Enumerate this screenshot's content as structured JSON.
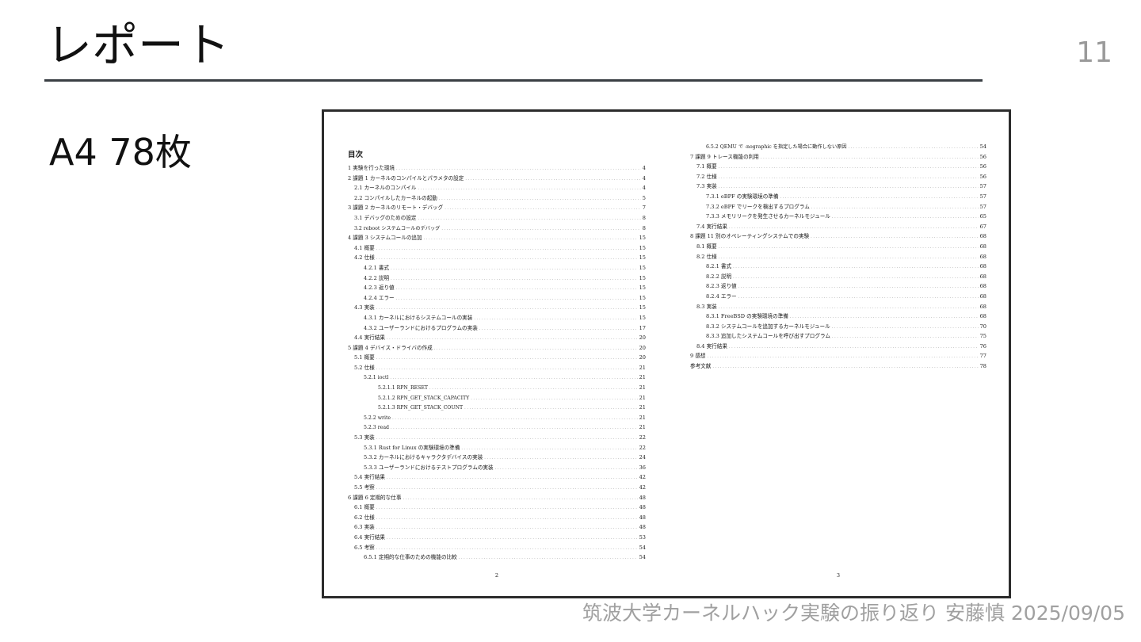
{
  "slide": {
    "title": "レポート",
    "page_number": "11",
    "summary": "A4 78枚",
    "footer": "筑波大学カーネルハック実験の振り返り 安藤慎 2025/09/05"
  },
  "document": {
    "left_page": {
      "heading": "目次",
      "page_number": "2",
      "entries": [
        {
          "level": 0,
          "text": "1 実験を行った環境",
          "page": "4"
        },
        {
          "level": 0,
          "text": "2 課題 1 カーネルのコンパイルとパラメタの設定",
          "page": "4"
        },
        {
          "level": 1,
          "text": "2.1 カーネルのコンパイル",
          "page": "4"
        },
        {
          "level": 1,
          "text": "2.2 コンパイルしたカーネルの起動",
          "page": "5"
        },
        {
          "level": 0,
          "text": "3 課題 2 カーネルのリモート・デバッグ",
          "page": "7"
        },
        {
          "level": 1,
          "text": "3.1 デバッグのための設定",
          "page": "8"
        },
        {
          "level": 1,
          "text": "3.2 reboot システムコールのデバッグ",
          "page": "8"
        },
        {
          "level": 0,
          "text": "4 課題 3 システムコールの追加",
          "page": "15"
        },
        {
          "level": 1,
          "text": "4.1 概要",
          "page": "15"
        },
        {
          "level": 1,
          "text": "4.2 仕様",
          "page": "15"
        },
        {
          "level": 2,
          "text": "4.2.1 書式",
          "page": "15"
        },
        {
          "level": 2,
          "text": "4.2.2 説明",
          "page": "15"
        },
        {
          "level": 2,
          "text": "4.2.3 返り値",
          "page": "15"
        },
        {
          "level": 2,
          "text": "4.2.4 エラー",
          "page": "15"
        },
        {
          "level": 1,
          "text": "4.3 実装",
          "page": "15"
        },
        {
          "level": 2,
          "text": "4.3.1 カーネルにおけるシステムコールの実装",
          "page": "15"
        },
        {
          "level": 2,
          "text": "4.3.2 ユーザーランドにおけるプログラムの実装",
          "page": "17"
        },
        {
          "level": 1,
          "text": "4.4 実行結果",
          "page": "20"
        },
        {
          "level": 0,
          "text": "5 課題 4 デバイス・ドライバの作成",
          "page": "20"
        },
        {
          "level": 1,
          "text": "5.1 概要",
          "page": "20"
        },
        {
          "level": 1,
          "text": "5.2 仕様",
          "page": "21"
        },
        {
          "level": 2,
          "text": "5.2.1 ioctl",
          "page": "21"
        },
        {
          "level": 3,
          "text": "5.2.1.1 RPN_RESET",
          "page": "21"
        },
        {
          "level": 3,
          "text": "5.2.1.2 RPN_GET_STACK_CAPACITY",
          "page": "21"
        },
        {
          "level": 3,
          "text": "5.2.1.3 RPN_GET_STACK_COUNT",
          "page": "21"
        },
        {
          "level": 2,
          "text": "5.2.2 write",
          "page": "21"
        },
        {
          "level": 2,
          "text": "5.2.3 read",
          "page": "21"
        },
        {
          "level": 1,
          "text": "5.3 実装",
          "page": "22"
        },
        {
          "level": 2,
          "text": "5.3.1 Rust for Linux の実験環境の準備",
          "page": "22"
        },
        {
          "level": 2,
          "text": "5.3.2 カーネルにおけるキャラクタデバイスの実装",
          "page": "24"
        },
        {
          "level": 2,
          "text": "5.3.3 ユーザーランドにおけるテストプログラムの実装",
          "page": "36"
        },
        {
          "level": 1,
          "text": "5.4 実行結果",
          "page": "42"
        },
        {
          "level": 1,
          "text": "5.5 考察",
          "page": "42"
        },
        {
          "level": 0,
          "text": "6 課題 6 定期的な仕事",
          "page": "48"
        },
        {
          "level": 1,
          "text": "6.1 概要",
          "page": "48"
        },
        {
          "level": 1,
          "text": "6.2 仕様",
          "page": "48"
        },
        {
          "level": 1,
          "text": "6.3 実装",
          "page": "48"
        },
        {
          "level": 1,
          "text": "6.4 実行結果",
          "page": "53"
        },
        {
          "level": 1,
          "text": "6.5 考察",
          "page": "54"
        },
        {
          "level": 2,
          "text": "6.5.1 定期的な仕事のための機能の比較",
          "page": "54"
        }
      ]
    },
    "right_page": {
      "page_number": "3",
      "entries": [
        {
          "level": 2,
          "text": "6.5.2 QEMU で -nographic を指定した場合に動作しない原因",
          "page": "54"
        },
        {
          "level": 0,
          "text": "7 課題 9 トレース機能の利用",
          "page": "56"
        },
        {
          "level": 1,
          "text": "7.1 概要",
          "page": "56"
        },
        {
          "level": 1,
          "text": "7.2 仕様",
          "page": "56"
        },
        {
          "level": 1,
          "text": "7.3 実装",
          "page": "57"
        },
        {
          "level": 2,
          "text": "7.3.1 eBPF の実験環境の準備",
          "page": "57"
        },
        {
          "level": 2,
          "text": "7.3.2 eBPF でリークを検出するプログラム",
          "page": "57"
        },
        {
          "level": 2,
          "text": "7.3.3 メモリリークを発生させるカーネルモジュール",
          "page": "65"
        },
        {
          "level": 1,
          "text": "7.4 実行結果",
          "page": "67"
        },
        {
          "level": 0,
          "text": "8 課題 11 別のオペレーティングシステムでの実験",
          "page": "68"
        },
        {
          "level": 1,
          "text": "8.1 概要",
          "page": "68"
        },
        {
          "level": 1,
          "text": "8.2 仕様",
          "page": "68"
        },
        {
          "level": 2,
          "text": "8.2.1 書式",
          "page": "68"
        },
        {
          "level": 2,
          "text": "8.2.2 説明",
          "page": "68"
        },
        {
          "level": 2,
          "text": "8.2.3 返り値",
          "page": "68"
        },
        {
          "level": 2,
          "text": "8.2.4 エラー",
          "page": "68"
        },
        {
          "level": 1,
          "text": "8.3 実装",
          "page": "68"
        },
        {
          "level": 2,
          "text": "8.3.1 FreeBSD の実験環境の準備",
          "page": "68"
        },
        {
          "level": 2,
          "text": "8.3.2 システムコールを追加するカーネルモジュール",
          "page": "70"
        },
        {
          "level": 2,
          "text": "8.3.3 追加したシステムコールを呼び出すプログラム",
          "page": "75"
        },
        {
          "level": 1,
          "text": "8.4 実行結果",
          "page": "76"
        },
        {
          "level": 0,
          "text": "9 感想",
          "page": "77"
        },
        {
          "level": 0,
          "text": "参考文献",
          "page": "78"
        }
      ]
    }
  }
}
